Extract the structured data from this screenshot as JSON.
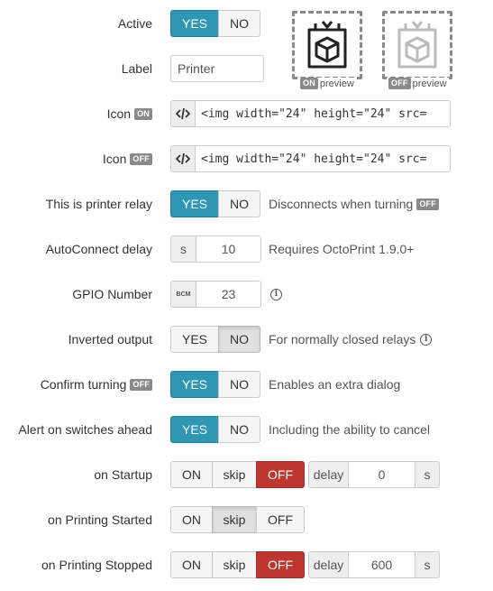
{
  "active": {
    "label": "Active",
    "yes": "YES",
    "no": "NO"
  },
  "label_field": {
    "label": "Label",
    "value": "Printer"
  },
  "icon_on": {
    "label": "Icon",
    "tag": "ON",
    "code": "<img width=\"24\" height=\"24\" src="
  },
  "icon_off": {
    "label": "Icon",
    "tag": "OFF",
    "code": "<img width=\"24\" height=\"24\" src="
  },
  "preview_on": {
    "tag": "ON",
    "text": "preview"
  },
  "preview_off": {
    "tag": "OFF",
    "text": "preview"
  },
  "printer_relay": {
    "label": "This is printer relay",
    "yes": "YES",
    "no": "NO",
    "hint": "Disconnects when turning",
    "hint_tag": "OFF"
  },
  "autoconnect": {
    "label": "AutoConnect delay",
    "unit": "s",
    "value": "10",
    "hint": "Requires OctoPrint 1.9.0+"
  },
  "gpio": {
    "label": "GPIO Number",
    "addon": "BCM",
    "value": "23",
    "info": "i"
  },
  "inverted": {
    "label": "Inverted output",
    "yes": "YES",
    "no": "NO",
    "hint": "For normally closed relays",
    "info": "i"
  },
  "confirm": {
    "label": "Confirm turning",
    "tag": "OFF",
    "yes": "YES",
    "no": "NO",
    "hint": "Enables an extra dialog"
  },
  "alert": {
    "label": "Alert on switches ahead",
    "yes": "YES",
    "no": "NO",
    "hint": "Including the ability to cancel"
  },
  "on_startup": {
    "label": "on Startup",
    "on": "ON",
    "skip": "skip",
    "off": "OFF",
    "delay_label": "delay",
    "delay_value": "0",
    "unit": "s",
    "selected": "OFF"
  },
  "on_printing_started": {
    "label": "on Printing Started",
    "on": "ON",
    "skip": "skip",
    "off": "OFF",
    "selected": "skip"
  },
  "on_printing_stopped": {
    "label": "on Printing Stopped",
    "on": "ON",
    "skip": "skip",
    "off": "OFF",
    "delay_label": "delay",
    "delay_value": "600",
    "unit": "s",
    "selected": "OFF"
  },
  "colors": {
    "yes_active": "#2f96b4",
    "off_active": "#bd362f",
    "tag_grey": "#8a8a8a"
  },
  "icons": {
    "code": "code-icon",
    "box": "cube-box-icon",
    "info": "info-circle-icon"
  }
}
